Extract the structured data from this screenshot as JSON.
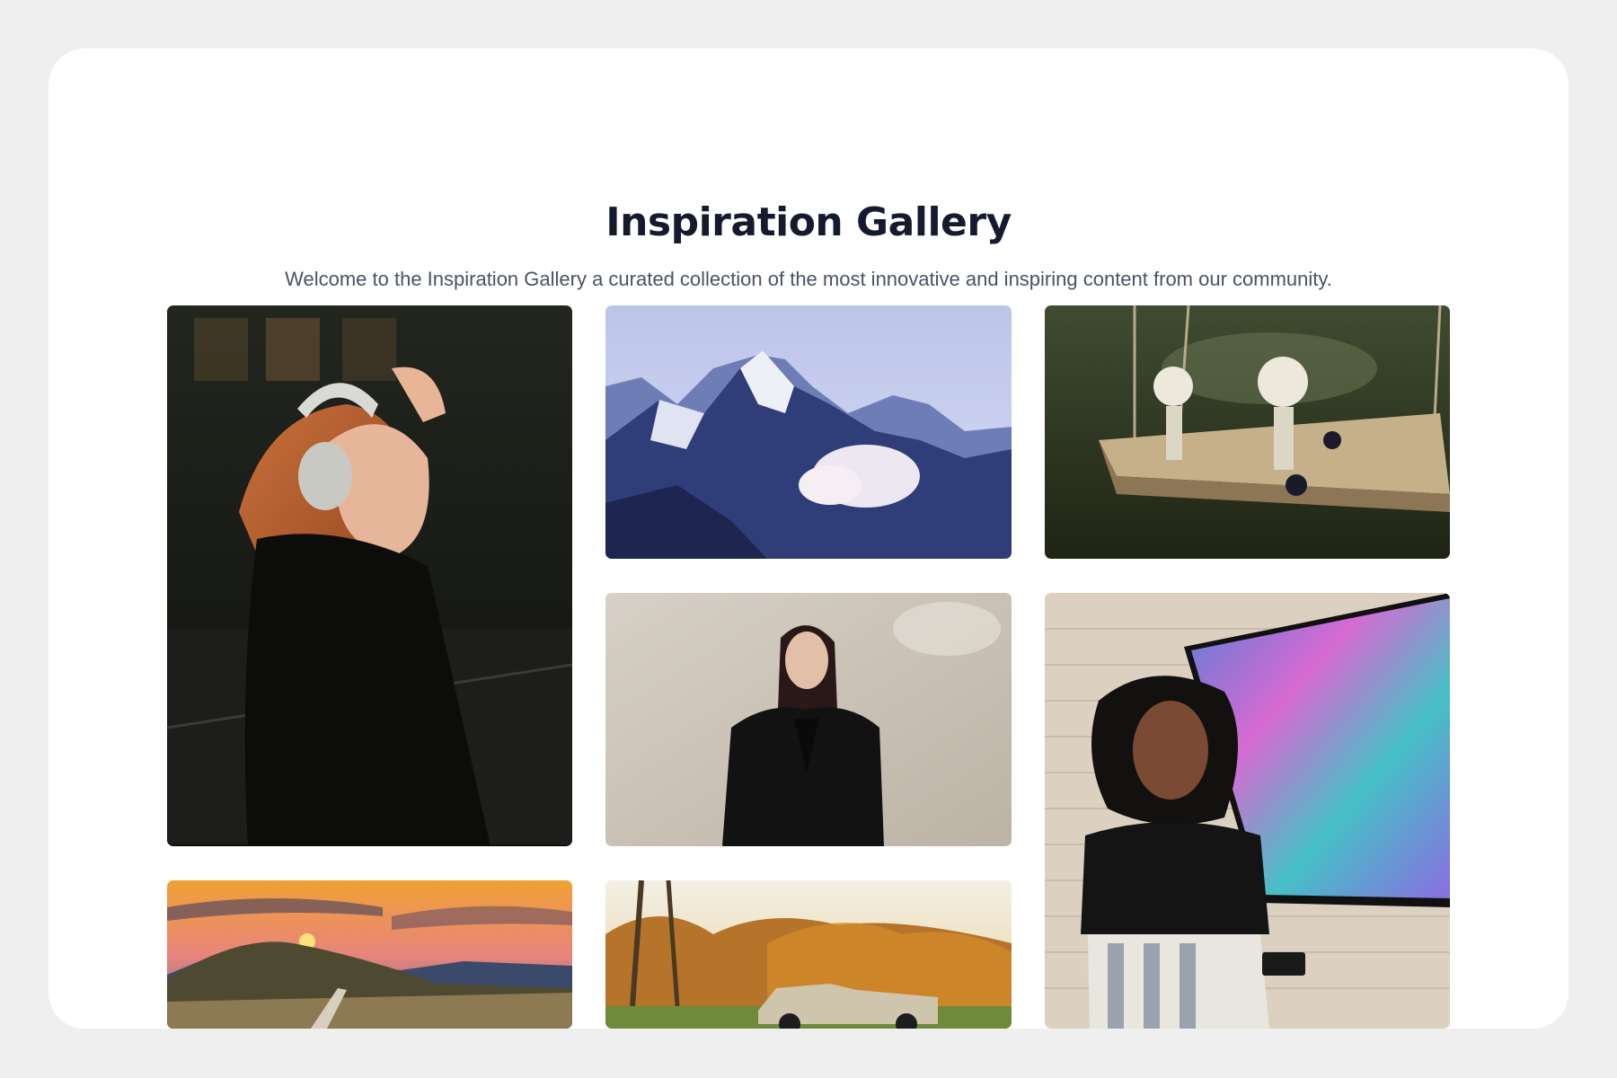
{
  "gallery": {
    "title": "Inspiration Gallery",
    "subtitle": "Welcome to the Inspiration Gallery a curated collection of the most innovative and inspiring content from our community.",
    "photos": [
      {
        "id": "headphones-woman",
        "subject": "woman with headphones"
      },
      {
        "id": "mountain",
        "subject": "snowy mountain peak"
      },
      {
        "id": "skeletons-swing",
        "subject": "skeletons on a swing"
      },
      {
        "id": "blazer-woman",
        "subject": "woman in black blazer"
      },
      {
        "id": "tv-woman",
        "subject": "woman near colorful tv screen"
      },
      {
        "id": "sunset-hills",
        "subject": "sunset over hills"
      },
      {
        "id": "vintage-car",
        "subject": "vintage car in autumn"
      }
    ]
  },
  "colors": {
    "page_bg": "#efefef",
    "card_bg": "#ffffff",
    "title": "#151a2e",
    "subtitle": "#4b5262"
  }
}
